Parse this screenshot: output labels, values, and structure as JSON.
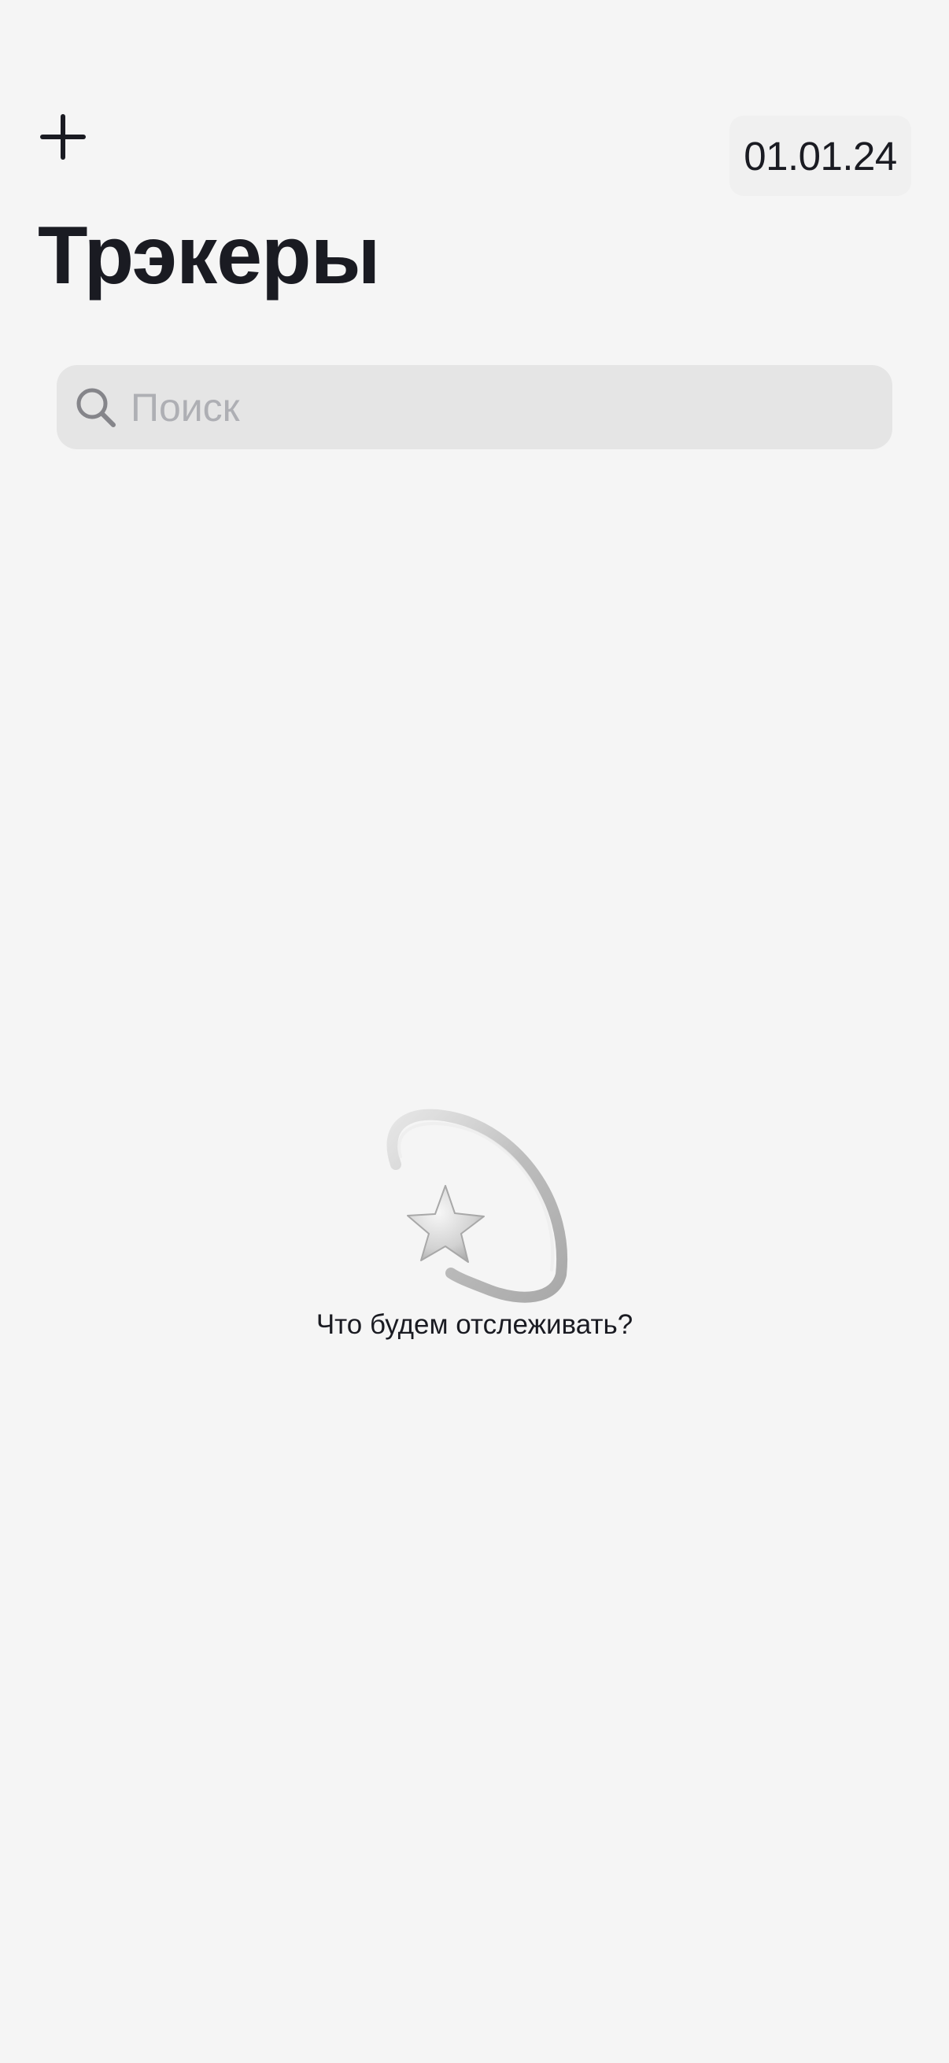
{
  "header": {
    "add_icon": "plus-icon",
    "date": "01.01.24",
    "title": "Трэкеры"
  },
  "search": {
    "icon": "search-icon",
    "placeholder": "Поиск",
    "value": ""
  },
  "empty_state": {
    "icon": "shooting-star-icon",
    "message": "Что будем отслеживать?"
  },
  "colors": {
    "background": "#f5f5f5",
    "text": "#1a1b22",
    "search_background": "#e5e5e5",
    "placeholder": "#aeafb4",
    "date_chip_background": "#f0f0f0"
  }
}
